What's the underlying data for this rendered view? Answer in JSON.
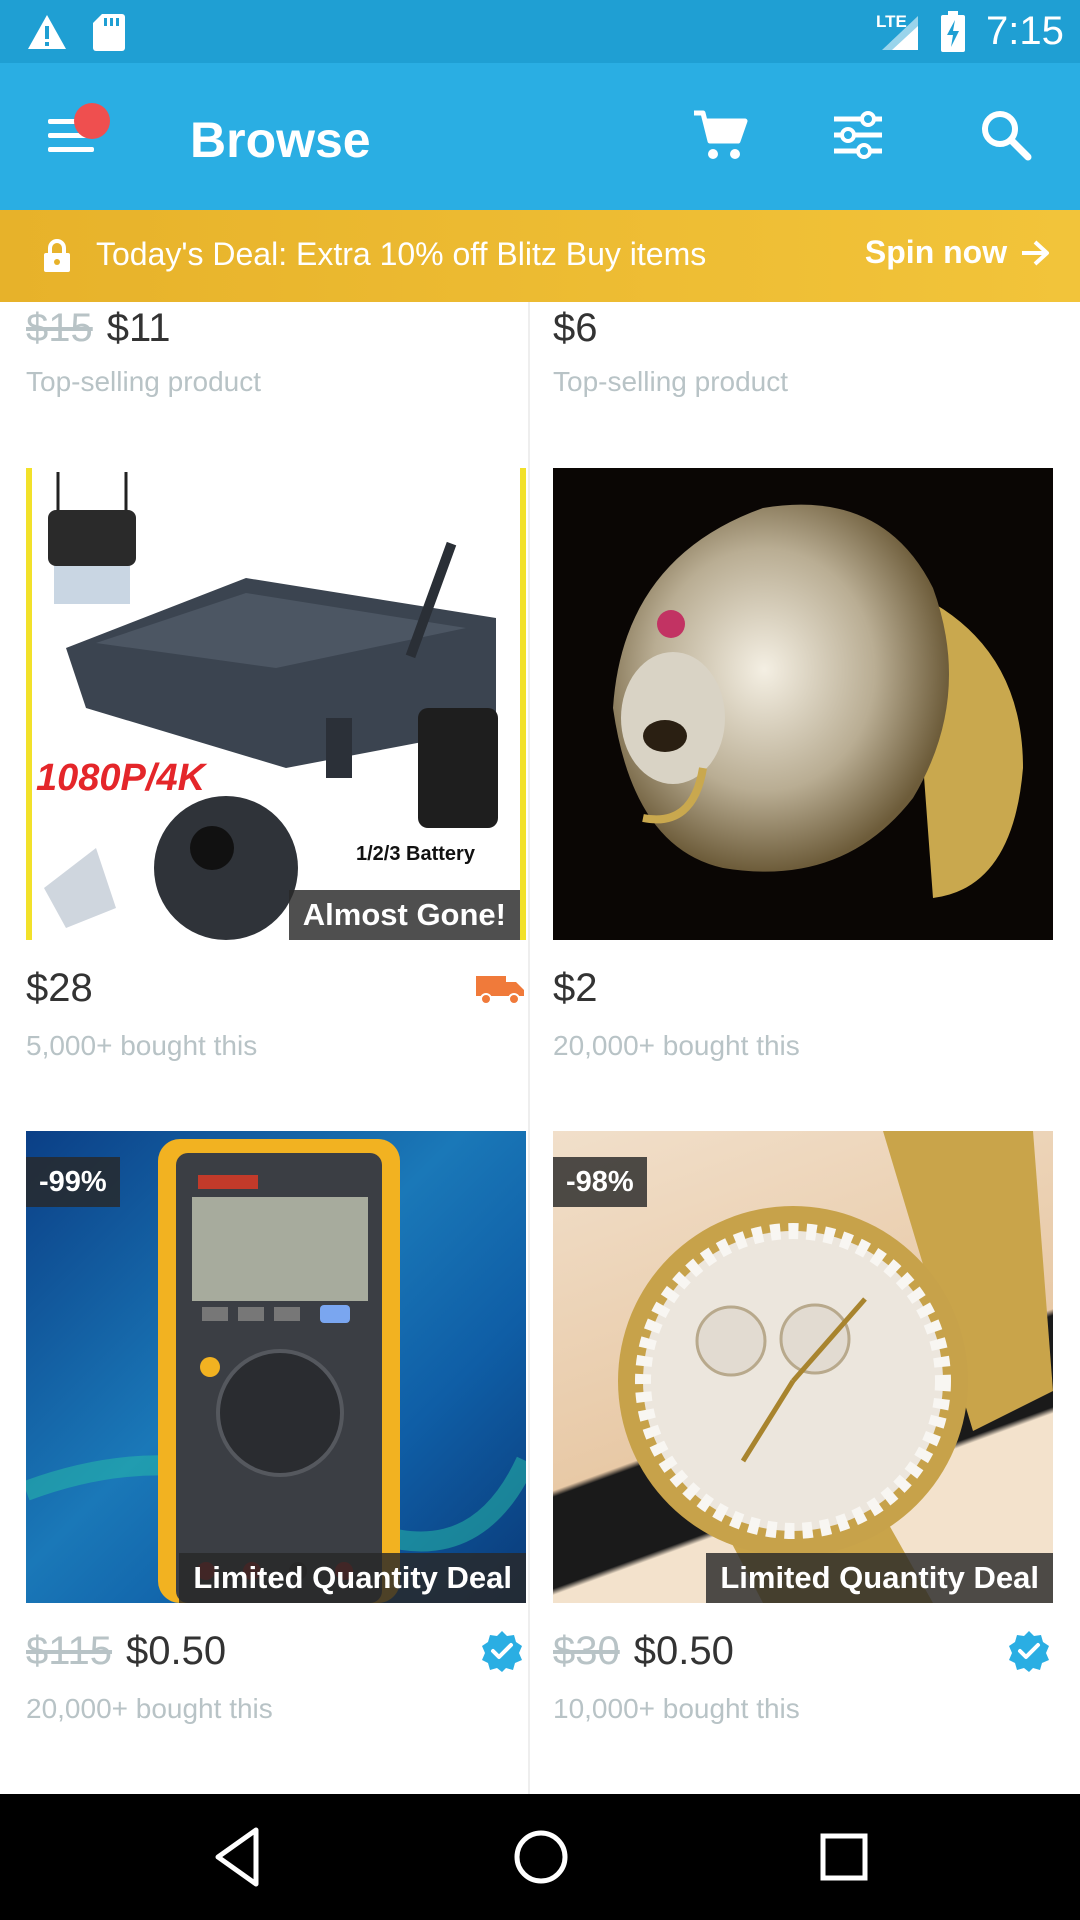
{
  "status_bar": {
    "network": "LTE",
    "time": "7:15"
  },
  "app_bar": {
    "title": "Browse"
  },
  "deal_banner": {
    "text": "Today's Deal: Extra 10% off Blitz Buy items",
    "action": "Spin now"
  },
  "products": [
    {
      "old_price": "$15",
      "price": "$11",
      "subtitle": "Top-selling product"
    },
    {
      "old_price": "",
      "price": "$6",
      "subtitle": "Top-selling product"
    },
    {
      "price": "$28",
      "subtitle": "5,000+ bought this",
      "ribbon": "Almost Gone!",
      "image_text": "1080P/4K",
      "image_caption": "1/2/3 Battery"
    },
    {
      "price": "$2",
      "subtitle": "20,000+ bought this"
    },
    {
      "discount": "-99%",
      "old_price": "$115",
      "price": "$0.50",
      "subtitle": "20,000+ bought this",
      "ribbon": "Limited Quantity Deal"
    },
    {
      "discount": "-98%",
      "old_price": "$30",
      "price": "$0.50",
      "subtitle": "10,000+ bought this",
      "ribbon": "Limited Quantity Deal"
    }
  ],
  "colors": {
    "status_bar": "#1f9fd3",
    "app_bar": "#2aaee3",
    "deal_banner": "#eab72e",
    "notification_dot": "#ef4f4f",
    "verified": "#2aaee3",
    "shipping": "#f07a3a"
  },
  "icons": [
    "warning-icon",
    "sd-card-icon",
    "signal-icon",
    "battery-charging-icon",
    "menu-icon",
    "cart-icon",
    "filter-icon",
    "search-icon",
    "lock-icon",
    "arrow-right-icon",
    "shipping-truck-icon",
    "verified-icon",
    "back-icon",
    "home-icon",
    "recents-icon"
  ]
}
